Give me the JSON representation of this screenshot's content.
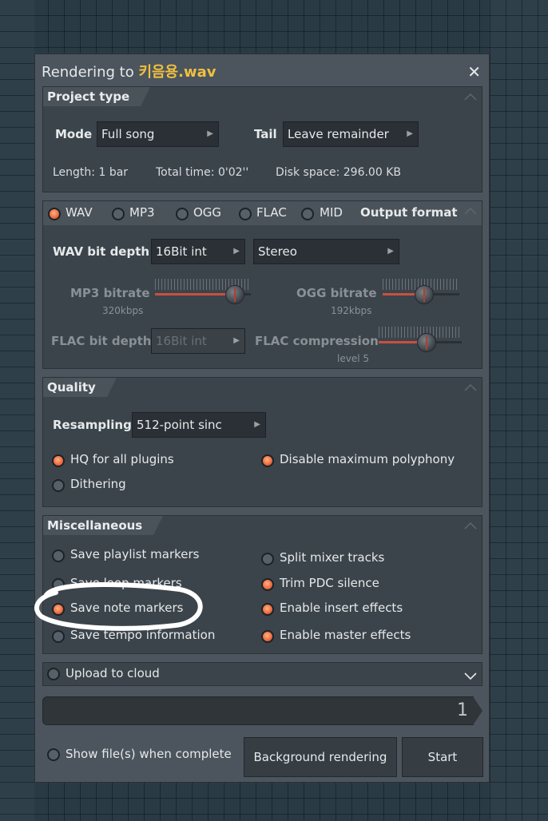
{
  "dialog": {
    "title_prefix": "Rendering to ",
    "filename": "키음용.wav",
    "close_glyph": "✕"
  },
  "project_type": {
    "header": "Project type",
    "mode_label": "Mode",
    "mode_value": "Full song",
    "tail_label": "Tail",
    "tail_value": "Leave remainder",
    "length": "Length: 1 bar",
    "total_time": "Total time: 0'02''",
    "disk_space": "Disk space: 296.00 KB"
  },
  "output_format": {
    "header": "Output format",
    "formats": [
      {
        "label": "WAV",
        "checked": true
      },
      {
        "label": "MP3",
        "checked": false
      },
      {
        "label": "OGG",
        "checked": false
      },
      {
        "label": "FLAC",
        "checked": false
      },
      {
        "label": "MID",
        "checked": false
      }
    ],
    "wav_bit_depth_label": "WAV bit depth",
    "wav_bit_depth_value": "16Bit int",
    "channels_value": "Stereo",
    "mp3_bitrate_label": "MP3 bitrate",
    "mp3_bitrate_value": "320kbps",
    "mp3_bitrate_level": 0.92,
    "ogg_bitrate_label": "OGG bitrate",
    "ogg_bitrate_value": "192kbps",
    "ogg_bitrate_level": 0.55,
    "flac_bit_depth_label": "FLAC bit depth",
    "flac_bit_depth_value": "16Bit int",
    "flac_compression_label": "FLAC compression",
    "flac_compression_value": "level 5",
    "flac_compression_level": 0.6
  },
  "quality": {
    "header": "Quality",
    "resampling_label": "Resampling",
    "resampling_value": "512-point sinc",
    "hq_plugins": {
      "label": "HQ for all plugins",
      "checked": true
    },
    "disable_polyphony": {
      "label": "Disable maximum polyphony",
      "checked": true
    },
    "dithering": {
      "label": "Dithering",
      "checked": false
    }
  },
  "misc": {
    "header": "Miscellaneous",
    "save_playlist_markers": {
      "label": "Save playlist markers",
      "checked": false
    },
    "save_loop_markers": {
      "label": "Save loop markers",
      "checked": false
    },
    "save_note_markers": {
      "label": "Save note markers",
      "checked": true
    },
    "save_tempo_information": {
      "label": "Save tempo information",
      "checked": false
    },
    "split_mixer_tracks": {
      "label": "Split mixer tracks",
      "checked": false
    },
    "trim_pdc_silence": {
      "label": "Trim PDC silence",
      "checked": true
    },
    "enable_insert_effects": {
      "label": "Enable insert effects",
      "checked": true
    },
    "enable_master_effects": {
      "label": "Enable master effects",
      "checked": true
    }
  },
  "upload": {
    "label": "Upload to cloud",
    "checked": false
  },
  "progress": {
    "value": "1"
  },
  "footer": {
    "show_files": {
      "label": "Show file(s) when complete",
      "checked": false
    },
    "background_rendering": "Background rendering",
    "start": "Start"
  },
  "colors": {
    "radio_on": "#f07040",
    "filename": "#f0c040",
    "annotation": "#ffffff"
  }
}
